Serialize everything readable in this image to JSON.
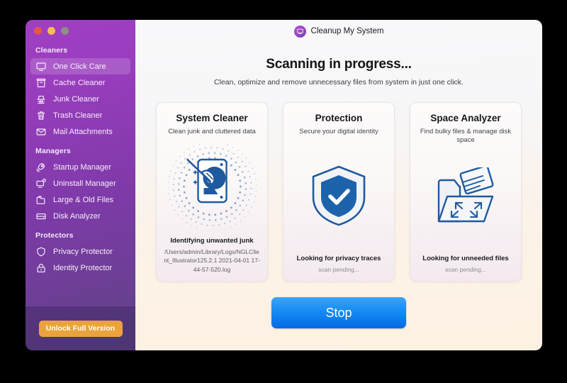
{
  "window": {
    "traffic_lights": [
      "close",
      "minimize",
      "zoom"
    ],
    "app_title": "Cleanup My System",
    "app_logo_icon": "monitor-icon"
  },
  "sidebar": {
    "groups": [
      {
        "title": "Cleaners",
        "items": [
          {
            "label": "One Click Care",
            "icon": "monitor-icon",
            "active": true
          },
          {
            "label": "Cache Cleaner",
            "icon": "cache-box-icon",
            "active": false
          },
          {
            "label": "Junk Cleaner",
            "icon": "broom-icon",
            "active": false
          },
          {
            "label": "Trash Cleaner",
            "icon": "trash-icon",
            "active": false
          },
          {
            "label": "Mail Attachments",
            "icon": "envelope-icon",
            "active": false
          }
        ]
      },
      {
        "title": "Managers",
        "items": [
          {
            "label": "Startup Manager",
            "icon": "rocket-icon",
            "active": false
          },
          {
            "label": "Uninstall Manager",
            "icon": "monitor-gear-icon",
            "active": false
          },
          {
            "label": "Large & Old Files",
            "icon": "folder-icon",
            "active": false
          },
          {
            "label": "Disk Analyzer",
            "icon": "disk-drive-icon",
            "active": false
          }
        ]
      },
      {
        "title": "Protectors",
        "items": [
          {
            "label": "Privacy Protector",
            "icon": "shield-icon",
            "active": false
          },
          {
            "label": "Identity Protector",
            "icon": "lock-icon",
            "active": false
          }
        ]
      }
    ],
    "unlock_button": "Unlock Full Version"
  },
  "main": {
    "scan_title": "Scanning in progress...",
    "scan_subtitle": "Clean, optimize and remove unnecessary files from system in just one click.",
    "cards": [
      {
        "title": "System Cleaner",
        "subtitle": "Clean junk and cluttered data",
        "icon": "disk-broom-icon",
        "status": "Identifying unwanted junk",
        "detail": "/Users/admin/Library/Logs/NGLClient_Illustrator125.2.1 2021-04-01 17-44-57-520.log",
        "pending": false
      },
      {
        "title": "Protection",
        "subtitle": "Secure your digital identity",
        "icon": "shield-check-icon",
        "status": "Looking for privacy traces",
        "detail": "scan pending...",
        "pending": true
      },
      {
        "title": "Space Analyzer",
        "subtitle": "Find bulky files & manage disk space",
        "icon": "folder-expand-icon",
        "status": "Looking for unneeded files",
        "detail": "scan pending...",
        "pending": true
      }
    ],
    "stop_button": "Stop"
  },
  "colors": {
    "sidebar_top": "#a03fc2",
    "sidebar_bottom": "#5d4385",
    "accent_orange": "#eaa33c",
    "accent_blue": "#1287f2",
    "icon_blue": "#205a9e"
  }
}
